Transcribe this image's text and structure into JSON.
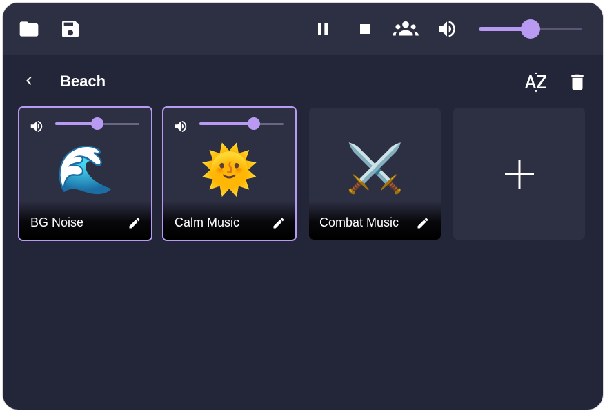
{
  "toolbar": {
    "left_icons": [
      "folder-icon",
      "save-icon"
    ],
    "right_icons": [
      "pause-icon",
      "stop-icon",
      "players-icon",
      "volume-icon"
    ],
    "master_volume": 0.5
  },
  "header": {
    "title": "Beach",
    "back_icon": "chevron-left-icon",
    "sort_icon": "sort-az-icon",
    "delete_icon": "trash-icon"
  },
  "tiles": [
    {
      "name": "BG Noise",
      "emoji": "🌊",
      "playing": true,
      "volume": 0.5
    },
    {
      "name": "Calm Music",
      "emoji": "🌞",
      "playing": true,
      "volume": 0.65
    },
    {
      "name": "Combat Music",
      "emoji": "⚔️",
      "playing": false,
      "volume": null
    }
  ],
  "add_tile": {
    "icon": "plus-icon"
  },
  "colors": {
    "accent": "#b99af2",
    "background": "#232538",
    "surface": "#2d2f43"
  }
}
